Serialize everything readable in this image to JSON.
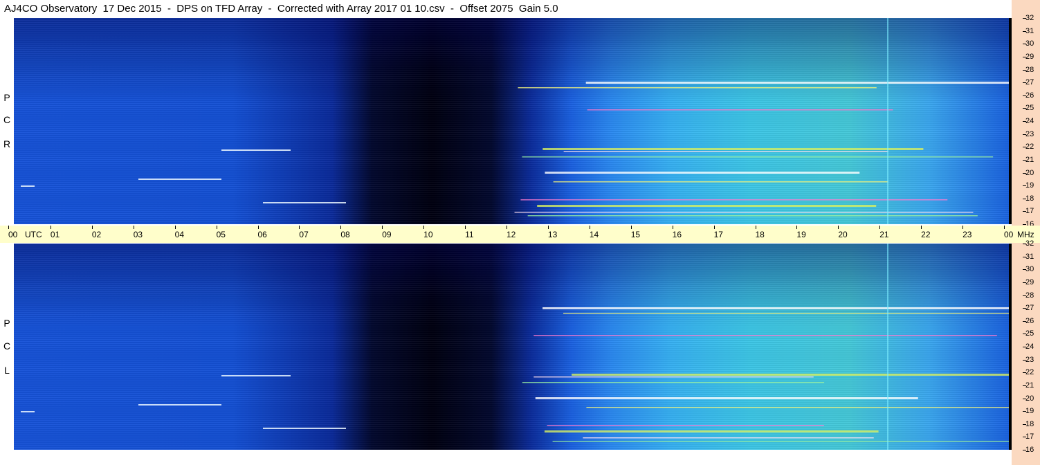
{
  "title": "AJ4CO Observatory  17 Dec 2015  -  DPS on TFD Array  -  Corrected with Array 2017 01 10.csv  -  Offset 2075  Gain 5.0",
  "panels": [
    {
      "id": "rcp",
      "label": [
        "R",
        "C",
        "P"
      ]
    },
    {
      "id": "lcp",
      "label": [
        "L",
        "C",
        "P"
      ]
    }
  ],
  "x_axis": {
    "ticks": [
      "00",
      "01",
      "02",
      "03",
      "04",
      "05",
      "06",
      "07",
      "08",
      "09",
      "10",
      "11",
      "12",
      "13",
      "14",
      "15",
      "16",
      "17",
      "18",
      "19",
      "20",
      "21",
      "22",
      "23",
      "00"
    ],
    "unit_left": "UTC",
    "unit_right": "MHz"
  },
  "y_axis": {
    "ticks": [
      "32",
      "31",
      "30",
      "29",
      "28",
      "27",
      "26",
      "25",
      "24",
      "23",
      "22",
      "21",
      "20",
      "19",
      "18",
      "17",
      "16"
    ],
    "range_mhz": [
      16,
      32
    ]
  },
  "colors": {
    "scale_bg": "#fbd9c0",
    "utc_bar_bg": "#fffecb",
    "spectrogram_low": "#000010",
    "spectrogram_mid": "#1450d4",
    "spectrogram_high": "#44c8d8"
  }
}
